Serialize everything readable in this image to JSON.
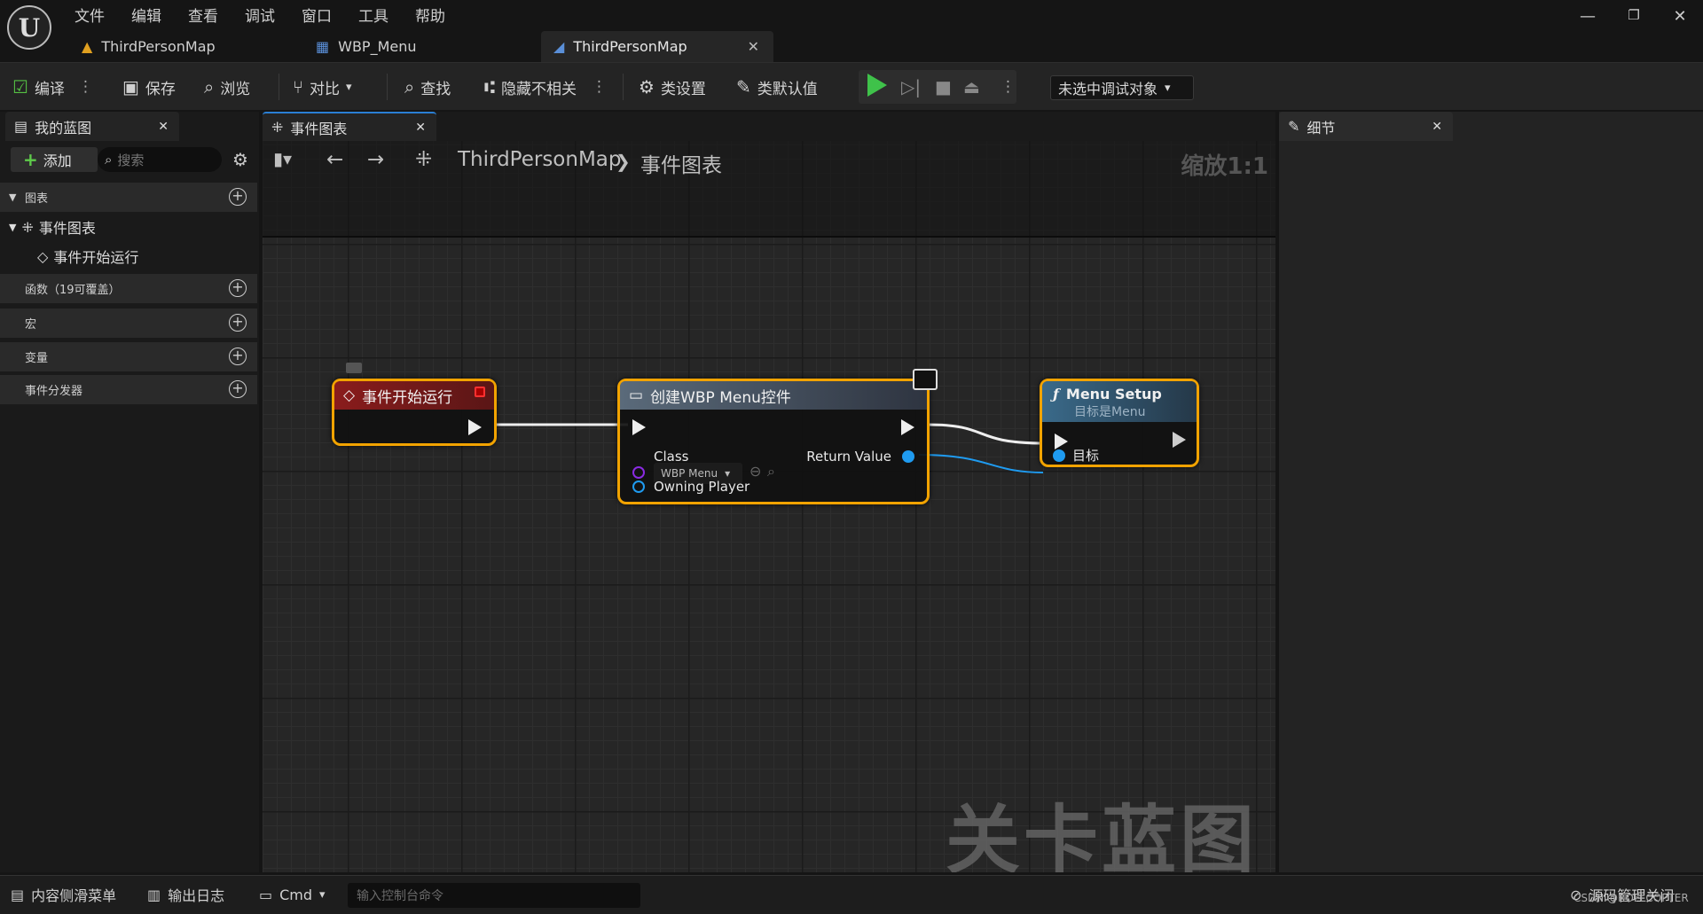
{
  "menu": [
    "文件",
    "编辑",
    "查看",
    "调试",
    "窗口",
    "工具",
    "帮助"
  ],
  "doc_tabs": [
    {
      "label": "ThirdPersonMap",
      "icon": "level-icon"
    },
    {
      "label": "WBP_Menu",
      "icon": "widget-blueprint-icon"
    },
    {
      "label": "ThirdPersonMap",
      "icon": "level-blueprint-icon",
      "active": true
    }
  ],
  "toolbar": {
    "compile": "编译",
    "save": "保存",
    "browse": "浏览",
    "diff": "对比",
    "find": "查找",
    "hide_unrelated": "隐藏不相关",
    "class_settings": "类设置",
    "class_defaults": "类默认值",
    "debug_target": "未选中调试对象"
  },
  "my_blueprint": {
    "tab": "我的蓝图",
    "add": "添加",
    "search_placeholder": "搜索",
    "sections": {
      "graphs": "图表",
      "event_graph": "事件图表",
      "begin_play": "事件开始运行",
      "functions": "函数（19可覆盖）",
      "macros": "宏",
      "variables": "变量",
      "dispatchers": "事件分发器"
    }
  },
  "graph": {
    "tab": "事件图表",
    "breadcrumb_root": "ThirdPersonMap",
    "breadcrumb_sep": "❯",
    "breadcrumb_leaf": "事件图表",
    "zoom": "缩放1:1",
    "watermark": "关卡蓝图"
  },
  "nodes": {
    "begin_play": {
      "title": "事件开始运行"
    },
    "create_widget": {
      "title": "创建WBP Menu控件",
      "class_label": "Class",
      "class_value": "WBP Menu",
      "return_label": "Return Value",
      "owning_label": "Owning Player"
    },
    "menu_setup": {
      "title": "Menu Setup",
      "subtitle": "目标是Menu",
      "target_label": "目标"
    }
  },
  "details": {
    "tab": "细节"
  },
  "statusbar": {
    "content_drawer": "内容侧滑菜单",
    "output_log": "输出日志",
    "cmd": "Cmd",
    "console_placeholder": "输入控制台命令",
    "source_control": "源码管理关闭",
    "credit": "CSDN @ROFLCOPTER"
  },
  "colors": {
    "accent_selection": "#f2a300",
    "event_node_header": "#8a1c1c",
    "function_node_header": "#3a6a8a",
    "object_pin": "#1f9bf0",
    "play_green": "#3fc24a"
  }
}
